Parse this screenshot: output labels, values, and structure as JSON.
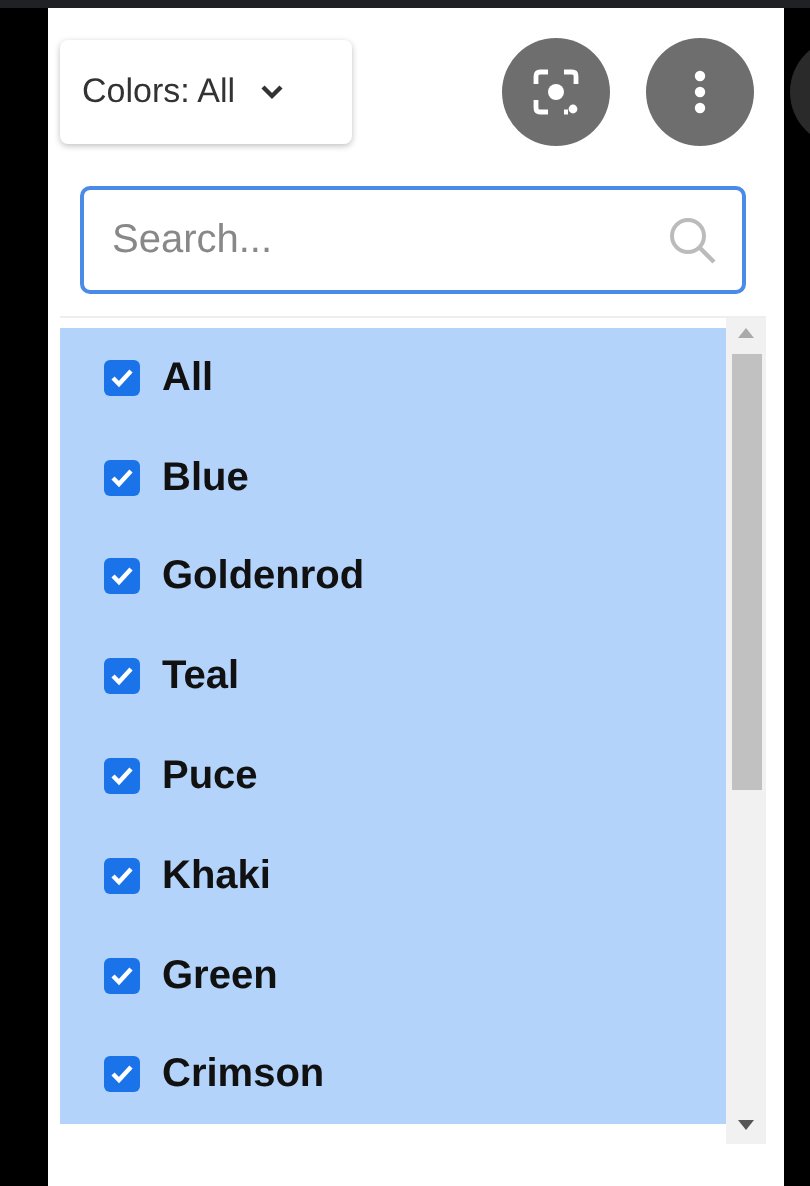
{
  "filter_button": {
    "label": "Colors: All"
  },
  "search": {
    "placeholder": "Search..."
  },
  "options": [
    {
      "label": "All",
      "checked": true,
      "selected": true
    },
    {
      "label": "Blue",
      "checked": true,
      "selected": true
    },
    {
      "label": "Goldenrod",
      "checked": true,
      "selected": true
    },
    {
      "label": "Teal",
      "checked": true,
      "selected": true
    },
    {
      "label": "Puce",
      "checked": true,
      "selected": true
    },
    {
      "label": "Khaki",
      "checked": true,
      "selected": true
    },
    {
      "label": "Green",
      "checked": true,
      "selected": true
    },
    {
      "label": "Crimson",
      "checked": true,
      "selected": true
    }
  ]
}
